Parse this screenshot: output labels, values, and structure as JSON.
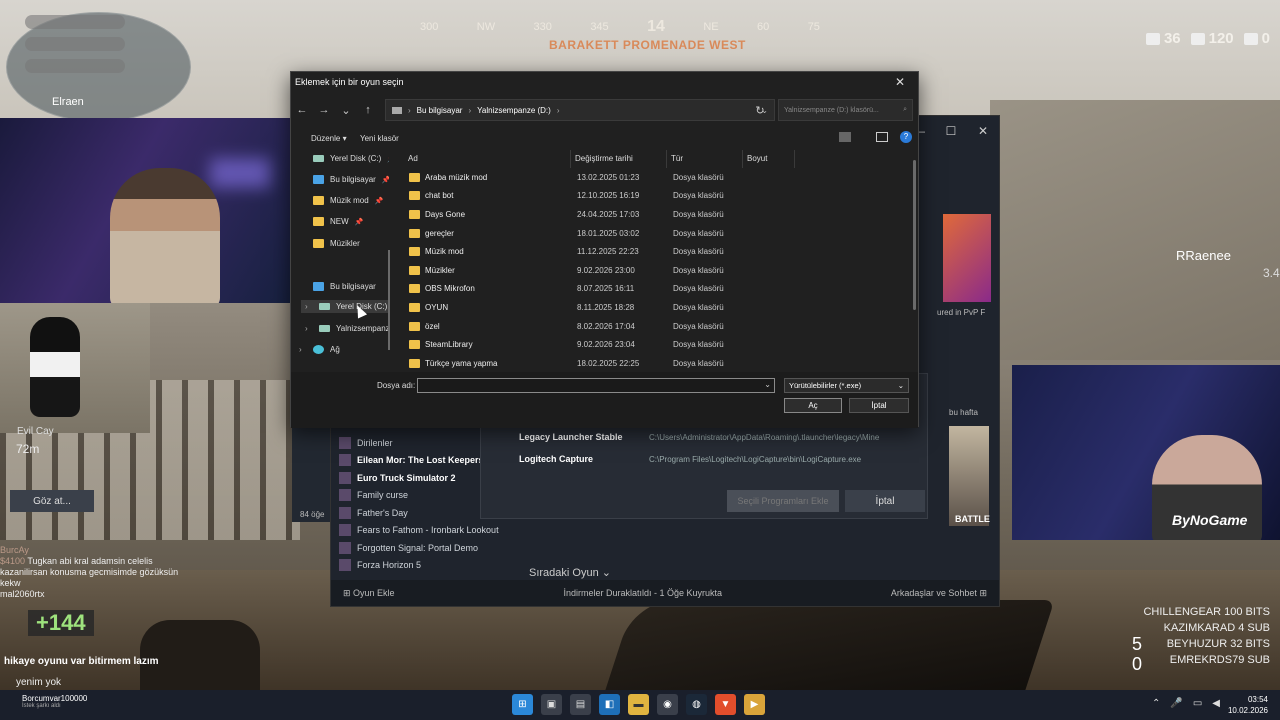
{
  "hud": {
    "compass": [
      "300",
      "NW",
      "330",
      "345",
      "14",
      "NE",
      "60",
      "75"
    ],
    "location": "BARAKETT PROMENADE WEST",
    "stats": [
      "36",
      "120",
      "0"
    ],
    "player_elraen": "Elraen",
    "player_rraenee": "RRaenee",
    "rraenee_value": "3.4",
    "evil_cay": "Evil Cay",
    "distance": "72m"
  },
  "overlay": {
    "brand": "ByNoGame",
    "bits_amount": "+144",
    "chat_lines": [
      {
        "name": "BurcAy",
        "text": ""
      },
      {
        "name": "$4100",
        "text": "Tugkan abi kral adamsin celelis kazanilirsan konusma gecmisimde gözüksün kekw"
      },
      {
        "name": "",
        "text": "mal2060rtx"
      }
    ],
    "chat_bottom": "hikaye oyunu var bitirmem lazım",
    "chat_bottom2": "yenim yok",
    "follower_name": "Borcumvar100000",
    "follower_sub": "İstek şarkı aldı",
    "leaderboard": [
      "CHILLENGEAR 100 BITS",
      "KAZIMKARAD 4 SUB",
      "BEYHUZUR 32 BITS",
      "EMREKRDS79 SUB"
    ],
    "score": [
      "5",
      "0"
    ]
  },
  "steam": {
    "library_items": [
      {
        "label": "Dirilenler",
        "bold": false
      },
      {
        "label": "Eilean Mor: The Lost Keepers",
        "bold": true
      },
      {
        "label": "Euro Truck Simulator 2",
        "bold": true
      },
      {
        "label": "Family curse",
        "bold": false
      },
      {
        "label": "Father's Day",
        "bold": false
      },
      {
        "label": "Fears to Fathom - Ironbark Lookout",
        "bold": false
      },
      {
        "label": "Forgotten Signal: Portal Demo",
        "bold": false
      },
      {
        "label": "Forza Horizon 5",
        "bold": false
      }
    ],
    "featured_caption": "ured in PvP F",
    "week_caption": "bu hafta",
    "game_title": "BATTLE",
    "next_game": "Sıradaki Oyun",
    "bottom_add_game": "Oyun Ekle",
    "bottom_downloads": "İndirmeler Duraklatıldı - 1 Öğe Kuyrukta",
    "bottom_friends": "Arkadaşlar ve Sohbet",
    "items_count": "84 öğe",
    "add_dialog": {
      "programs": [
        {
          "name": "Legacy Launcher Stable",
          "path": "C:\\Users\\Administrator\\AppData\\Roaming\\.tlauncher\\legacy\\Mine"
        },
        {
          "name": "Logitech Capture",
          "path": "C:\\Program Files\\Logitech\\LogiCapture\\bin\\LogiCapture.exe"
        }
      ],
      "browse": "Göz at...",
      "select": "Seçili Programları Ekle",
      "cancel": "İptal"
    }
  },
  "file_dialog": {
    "title": "Eklemek için bir oyun seçin",
    "breadcrumb": [
      "Bu bilgisayar",
      "Yalnizsempanze (D:)"
    ],
    "search_placeholder": "Yalnizsempanze (D:) klasörü...",
    "toolbar": {
      "organize": "Düzenle",
      "new_folder": "Yeni klasör"
    },
    "sidebar": [
      {
        "label": "Yerel Disk (C:)",
        "icon": "disk-icon",
        "pinned": true
      },
      {
        "label": "Bu bilgisayar",
        "icon": "pc-icon",
        "pinned": true
      },
      {
        "label": "Müzik mod",
        "icon": "folder-icon",
        "pinned": true
      },
      {
        "label": "NEW",
        "icon": "folder-icon",
        "pinned": true
      },
      {
        "label": "Müzikler",
        "icon": "folder-icon",
        "pinned": false
      },
      {
        "label": "Bu bilgisayar",
        "icon": "pc-icon",
        "pinned": false
      },
      {
        "label": "Yerel Disk (C:)",
        "icon": "disk-icon",
        "pinned": false
      },
      {
        "label": "Yalnizsempanze (D:)",
        "icon": "disk-icon",
        "pinned": false
      },
      {
        "label": "Ağ",
        "icon": "network-icon",
        "pinned": false
      }
    ],
    "columns": {
      "name": "Ad",
      "date": "Değiştirme tarihi",
      "type": "Tür",
      "size": "Boyut"
    },
    "files": [
      {
        "name": "Araba müzik mod",
        "date": "13.02.2025 01:23",
        "type": "Dosya klasörü"
      },
      {
        "name": "chat bot",
        "date": "12.10.2025 16:19",
        "type": "Dosya klasörü"
      },
      {
        "name": "Days Gone",
        "date": "24.04.2025 17:03",
        "type": "Dosya klasörü"
      },
      {
        "name": "gereçler",
        "date": "18.01.2025 03:02",
        "type": "Dosya klasörü"
      },
      {
        "name": "Müzik mod",
        "date": "11.12.2025 22:23",
        "type": "Dosya klasörü"
      },
      {
        "name": "Müzikler",
        "date": "9.02.2026 23:00",
        "type": "Dosya klasörü"
      },
      {
        "name": "OBS Mikrofon",
        "date": "8.07.2025 16:11",
        "type": "Dosya klasörü"
      },
      {
        "name": "OYUN",
        "date": "8.11.2025 18:28",
        "type": "Dosya klasörü"
      },
      {
        "name": "özel",
        "date": "8.02.2026 17:04",
        "type": "Dosya klasörü"
      },
      {
        "name": "SteamLibrary",
        "date": "9.02.2026 23:04",
        "type": "Dosya klasörü"
      },
      {
        "name": "Türkçe yama yapma",
        "date": "18.02.2025 22:25",
        "type": "Dosya klasörü"
      }
    ],
    "filename_label": "Dosya adı:",
    "filename_value": "",
    "filetype": "Yürütülebilirler (*.exe)",
    "open": "Aç",
    "cancel": "İptal"
  },
  "taskbar": {
    "clock_time": "03:54",
    "clock_date": "10.02.2026"
  }
}
